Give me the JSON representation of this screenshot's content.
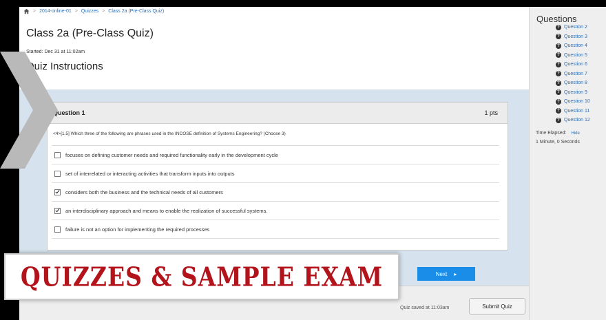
{
  "breadcrumb": {
    "items": [
      "2014-online-01",
      "Quizzes",
      "Class 2a (Pre-Class Quiz)"
    ],
    "separator": ">"
  },
  "quiz": {
    "title": "Class 2a (Pre-Class Quiz)",
    "started": "Started: Dec 31 at 11:02am",
    "instructions_heading": "Quiz Instructions"
  },
  "question": {
    "title": "Question 1",
    "points": "1 pts",
    "text": "<4>[1.5] Which three of the following are phrases used in the INCOSE definition of Systems Engineering? (Choose 3)",
    "answers": [
      {
        "label": "focuses on defining customer needs and required functionality early in the development cycle",
        "checked": false
      },
      {
        "label": "set of interrelated or interacting activities that transform inputs into outputs",
        "checked": false
      },
      {
        "label": "considers both the business and the technical needs of all customers",
        "checked": true
      },
      {
        "label": "an interdisciplinary approach and means to enable the realization of successful systems.",
        "checked": true
      },
      {
        "label": "failure is not an option for implementing the required processes",
        "checked": false
      }
    ]
  },
  "buttons": {
    "next": "Next",
    "next_arrow": "▸",
    "submit": "Submit Quiz"
  },
  "footer": {
    "saved": "Quiz saved at 11:03am"
  },
  "sidebar": {
    "title": "Questions",
    "questions": [
      "Question 2",
      "Question 3",
      "Question 4",
      "Question 5",
      "Question 6",
      "Question 7",
      "Question 8",
      "Question 9",
      "Question 10",
      "Question 11",
      "Question 12"
    ],
    "question_icon": "?",
    "time_label": "Time Elapsed:",
    "hide_link": "Hide",
    "time_value": "1 Minute, 0 Seconds"
  },
  "banner": {
    "text": "QUIZZES & SAMPLE EXAM"
  },
  "colors": {
    "link": "#2a6db5",
    "primary_button": "#1a8de8",
    "banner_text": "#b3131a",
    "content_background": "#d6e3ee"
  },
  "icons": {
    "home": "home-icon",
    "question_status": "question-mark-circle-icon",
    "chevron": "chevron-right-icon"
  }
}
